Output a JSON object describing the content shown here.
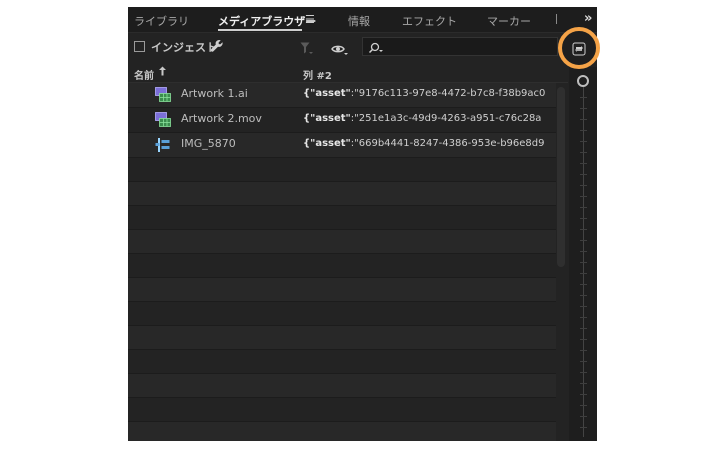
{
  "tabs": [
    {
      "label": "ライブラリ",
      "active": false
    },
    {
      "label": "メディアブラウザー",
      "active": true
    },
    {
      "label": "情報",
      "active": false
    },
    {
      "label": "エフェクト",
      "active": false
    },
    {
      "label": "マーカー",
      "active": false
    }
  ],
  "toolbar": {
    "ingest_label": "インジェスト",
    "search_value": ""
  },
  "columns": {
    "name": "名前",
    "col2": "列 #2"
  },
  "files": [
    {
      "name": "Artwork 1.ai",
      "meta_key": "{\"asset\"",
      "meta_value": ":\"9176c113-97e8-4472-b7c8-f38b9ac0",
      "icon": "sequence-icon"
    },
    {
      "name": "Artwork 2.mov",
      "meta_key": "{\"asset\"",
      "meta_value": ":\"251e1a3c-49d9-4263-a951-c76c28a",
      "icon": "sequence-icon"
    },
    {
      "name": "IMG_5870",
      "meta_key": "{\"asset\"",
      "meta_value": ":\"669b4441-8247-4386-953e-b96e8d9",
      "icon": "multicam-icon"
    }
  ],
  "colors": {
    "highlight": "#f5a347",
    "panel_bg": "#232323"
  }
}
